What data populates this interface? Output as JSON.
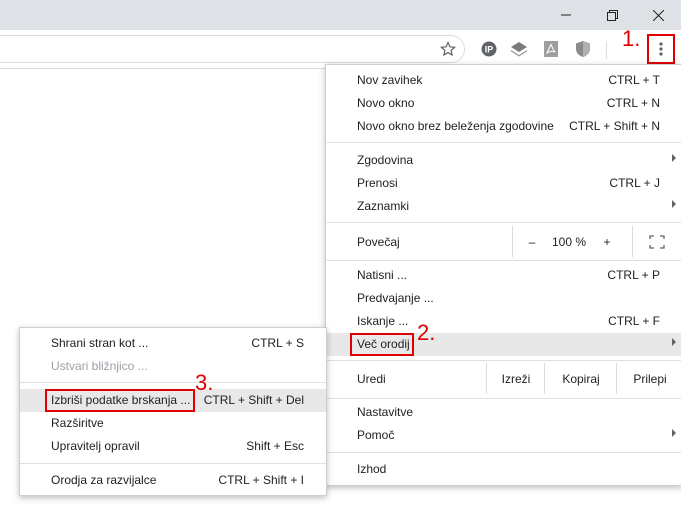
{
  "window": {
    "minimize_icon": "minimize-icon",
    "restore_icon": "restore-icon",
    "close_icon": "close-icon"
  },
  "toolbar": {
    "bookmark_icon": "star-icon",
    "extensions": [
      "ip-extension-icon",
      "layers-extension-icon",
      "pdf-extension-icon",
      "shield-extension-icon"
    ],
    "menu_icon": "three-dots-vertical-icon"
  },
  "annotations": {
    "a1": "1.",
    "a2": "2.",
    "a3": "3.",
    "color": "#e00000"
  },
  "menu": {
    "new_tab": {
      "label": "Nov zavihek",
      "shortcut": "CTRL + T"
    },
    "new_window": {
      "label": "Novo okno",
      "shortcut": "CTRL + N"
    },
    "incognito": {
      "label": "Novo okno brez beleženja zgodovine",
      "shortcut": "CTRL + Shift + N"
    },
    "history": {
      "label": "Zgodovina"
    },
    "downloads": {
      "label": "Prenosi",
      "shortcut": "CTRL + J"
    },
    "bookmarks": {
      "label": "Zaznamki"
    },
    "zoom": {
      "label": "Povečaj",
      "minus": "–",
      "value": "100 %",
      "plus": "+"
    },
    "print": {
      "label": "Natisni ...",
      "shortcut": "CTRL + P"
    },
    "cast": {
      "label": "Predvajanje ..."
    },
    "find": {
      "label": "Iskanje ...",
      "shortcut": "CTRL + F"
    },
    "more_tools": {
      "label": "Več orodij"
    },
    "edit": {
      "label": "Uredi",
      "cut": "Izreži",
      "copy": "Kopiraj",
      "paste": "Prilepi"
    },
    "settings": {
      "label": "Nastavitve"
    },
    "help": {
      "label": "Pomoč"
    },
    "exit": {
      "label": "Izhod"
    }
  },
  "submenu": {
    "save_page": {
      "label": "Shrani stran kot ...",
      "shortcut": "CTRL + S"
    },
    "create_shortcut": {
      "label": "Ustvari bližnjico ..."
    },
    "clear_data": {
      "label": "Izbriši podatke brskanja ...",
      "shortcut": "CTRL + Shift + Del"
    },
    "extensions": {
      "label": "Razširitve"
    },
    "task_manager": {
      "label": "Upravitelj opravil",
      "shortcut": "Shift + Esc"
    },
    "dev_tools": {
      "label": "Orodja za razvijalce",
      "shortcut": "CTRL + Shift + I"
    }
  }
}
